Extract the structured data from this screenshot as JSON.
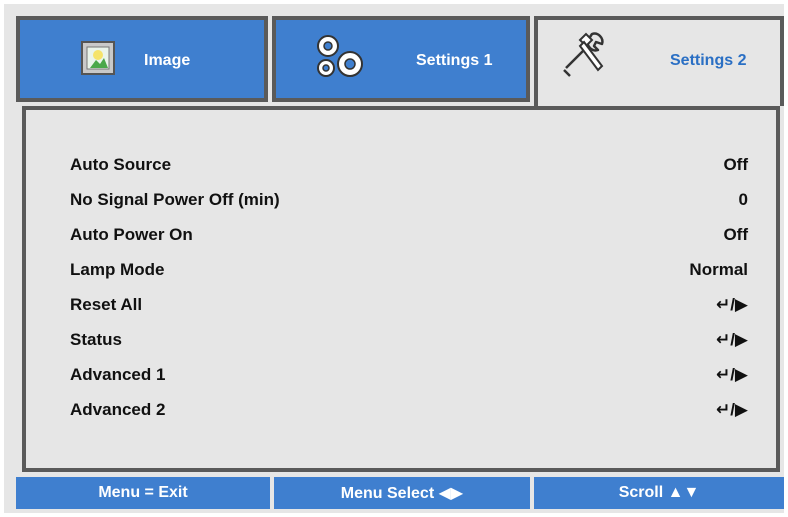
{
  "tabs": [
    {
      "label": "Image",
      "icon": "image-icon",
      "active": false
    },
    {
      "label": "Settings 1",
      "icon": "gears-icon",
      "active": false
    },
    {
      "label": "Settings 2",
      "icon": "tools-icon",
      "active": true
    }
  ],
  "menu": {
    "items": [
      {
        "label": "Auto Source",
        "value": "Off"
      },
      {
        "label": "No Signal Power Off (min)",
        "value": "0"
      },
      {
        "label": "Auto Power On",
        "value": "Off"
      },
      {
        "label": "Lamp Mode",
        "value": "Normal"
      },
      {
        "label": "Reset All",
        "value": "↵/▶"
      },
      {
        "label": "Status",
        "value": "↵/▶"
      },
      {
        "label": "Advanced 1",
        "value": "↵/▶"
      },
      {
        "label": "Advanced 2",
        "value": "↵/▶"
      }
    ]
  },
  "footer": {
    "exit": "Menu = Exit",
    "select": "Menu Select ◀▶",
    "scroll": "Scroll ▲▼"
  },
  "colors": {
    "accent_blue": "#3f7fcf",
    "active_tab_text": "#2a6fc4",
    "border": "#5a5a5a",
    "panel_bg": "#e6e6e6"
  }
}
